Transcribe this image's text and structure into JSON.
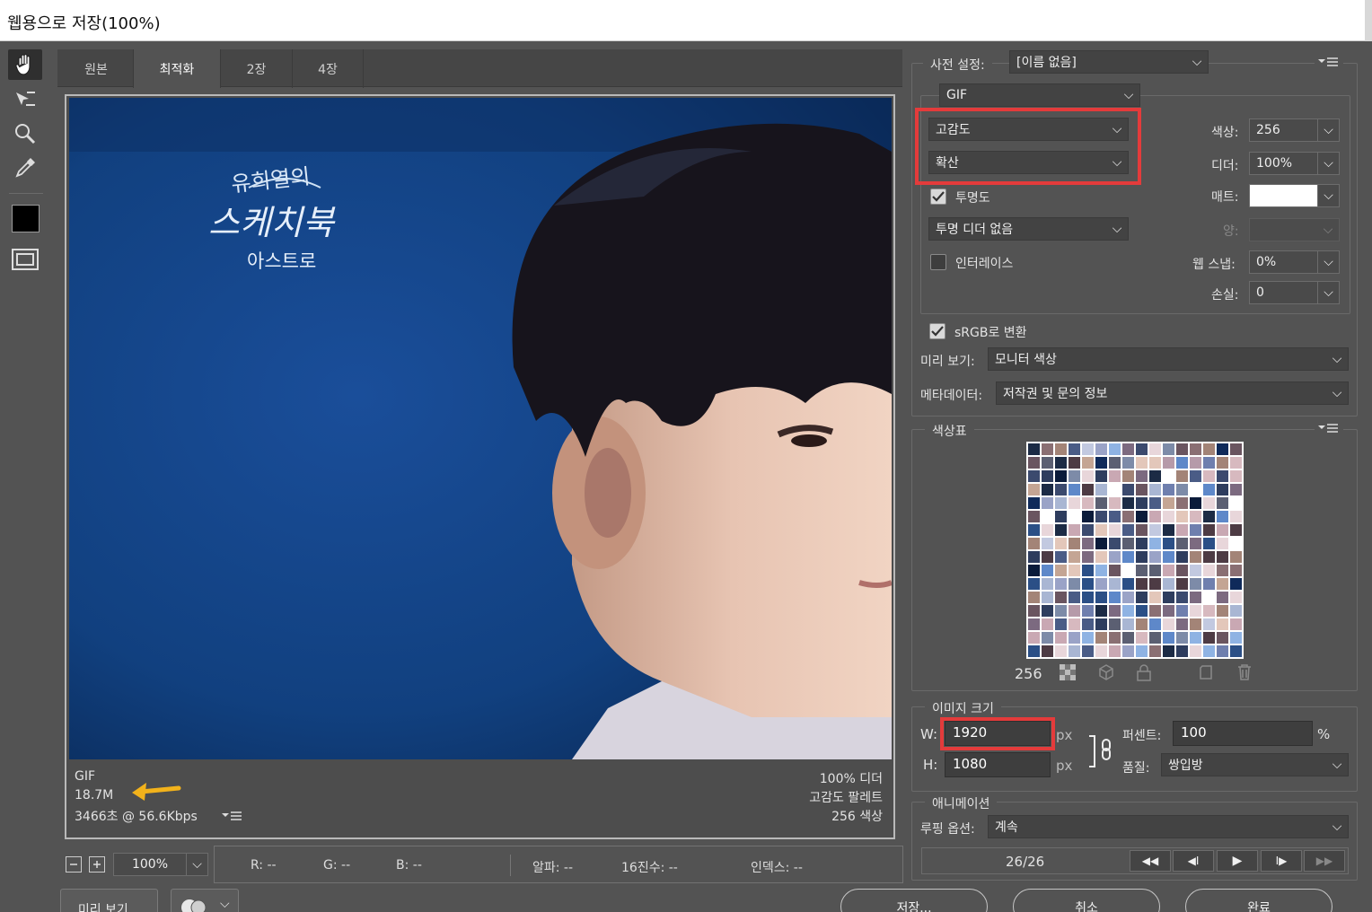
{
  "window": {
    "title": "웹용으로 저장(100%)"
  },
  "tabs": [
    {
      "label": "원본"
    },
    {
      "label": "최적화"
    },
    {
      "label": "2장"
    },
    {
      "label": "4장"
    }
  ],
  "preview": {
    "overlay_title": "유희열의",
    "overlay_logo": "스케치북",
    "overlay_subtitle": "아스트로",
    "info_left": {
      "format": "GIF",
      "size": "18.7M",
      "time": "3466초 @ 56.6Kbps"
    },
    "info_right": {
      "dither": "100% 디더",
      "palette": "고감도 팔레트",
      "colors": "256 색상"
    }
  },
  "bottom_bar": {
    "zoom": "100%",
    "r": "R: --",
    "g": "G: --",
    "b": "B: --",
    "alpha": "알파: --",
    "hex": "16진수: --",
    "index": "인덱스: --",
    "preview_button": "미리 보기...",
    "save": "저장...",
    "cancel": "취소",
    "done": "완료"
  },
  "settings": {
    "preset_label": "사전 설정:",
    "preset_value": "[이름 없음]",
    "format": "GIF",
    "reduction": "고감도",
    "dither_algo": "확산",
    "colors_label": "색상:",
    "colors_value": "256",
    "dither_label": "디더:",
    "dither_value": "100%",
    "transparency_label": "투명도",
    "transparency_checked": true,
    "matte_label": "매트:",
    "trans_dither": "투명 디더 없음",
    "amount_label": "양:",
    "interlace_label": "인터레이스",
    "interlace_checked": false,
    "websnap_label": "웹 스냅:",
    "websnap_value": "0%",
    "lossy_label": "손실:",
    "lossy_value": "0",
    "srgb_label": "sRGB로 변환",
    "srgb_checked": true,
    "preview_label": "미리 보기:",
    "preview_value": "모니터 색상",
    "metadata_label": "메타데이터:",
    "metadata_value": "저작권 및 문의 정보"
  },
  "color_table": {
    "title": "색상표",
    "count": "256"
  },
  "image_size": {
    "title": "이미지 크기",
    "w_label": "W:",
    "w_value": "1920",
    "h_label": "H:",
    "h_value": "1080",
    "unit": "px",
    "percent_label": "퍼센트:",
    "percent_value": "100",
    "percent_unit": "%",
    "quality_label": "품질:",
    "quality_value": "쌍입방"
  },
  "animation": {
    "title": "애니메이션",
    "loop_label": "루핑 옵션:",
    "loop_value": "계속",
    "frame": "26/26"
  },
  "colors": {
    "highlight": "#e43b3b",
    "arrow": "#f2b21b",
    "photo_bg": "#123a78"
  }
}
